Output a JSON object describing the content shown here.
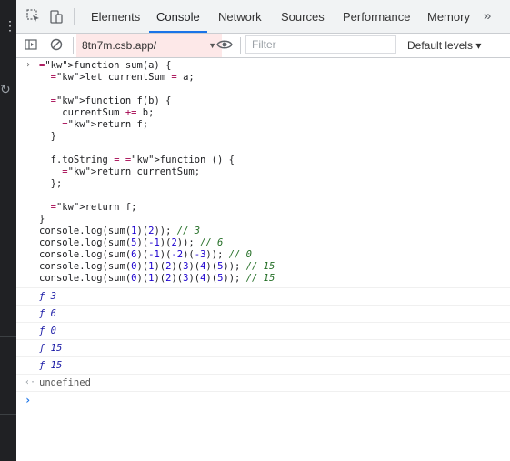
{
  "tabs": [
    {
      "label": "Elements"
    },
    {
      "label": "Console"
    },
    {
      "label": "Network"
    },
    {
      "label": "Sources"
    },
    {
      "label": "Performance"
    },
    {
      "label": "Memory"
    }
  ],
  "more_tabs_glyph": "»",
  "toolbar": {
    "context": "8tn7m.csb.app/",
    "filter_placeholder": "Filter",
    "levels": "Default levels ▾"
  },
  "console_input": {
    "lines": [
      "function sum(a) {",
      "  let currentSum = a;",
      "",
      "  function f(b) {",
      "    currentSum += b;",
      "    return f;",
      "  }",
      "",
      "  f.toString = function () {",
      "    return currentSum;",
      "  };",
      "",
      "  return f;",
      "}",
      "console.log(sum(1)(2)); // 3",
      "console.log(sum(5)(-1)(2)); // 6",
      "console.log(sum(6)(-1)(-2)(-3)); // 0",
      "console.log(sum(0)(1)(2)(3)(4)(5)); // 15",
      "console.log(sum(0)(1)(2)(3)(4)(5)); // 15"
    ]
  },
  "console_output": [
    {
      "text": "ƒ 3"
    },
    {
      "text": "ƒ 6"
    },
    {
      "text": "ƒ 0"
    },
    {
      "text": "ƒ 15"
    },
    {
      "text": "ƒ 15"
    }
  ],
  "return_value": "undefined",
  "colors": {
    "accent": "#1a73e8",
    "keyword": "#aa0d91",
    "comment": "#236e25",
    "number": "#1c00cf"
  }
}
